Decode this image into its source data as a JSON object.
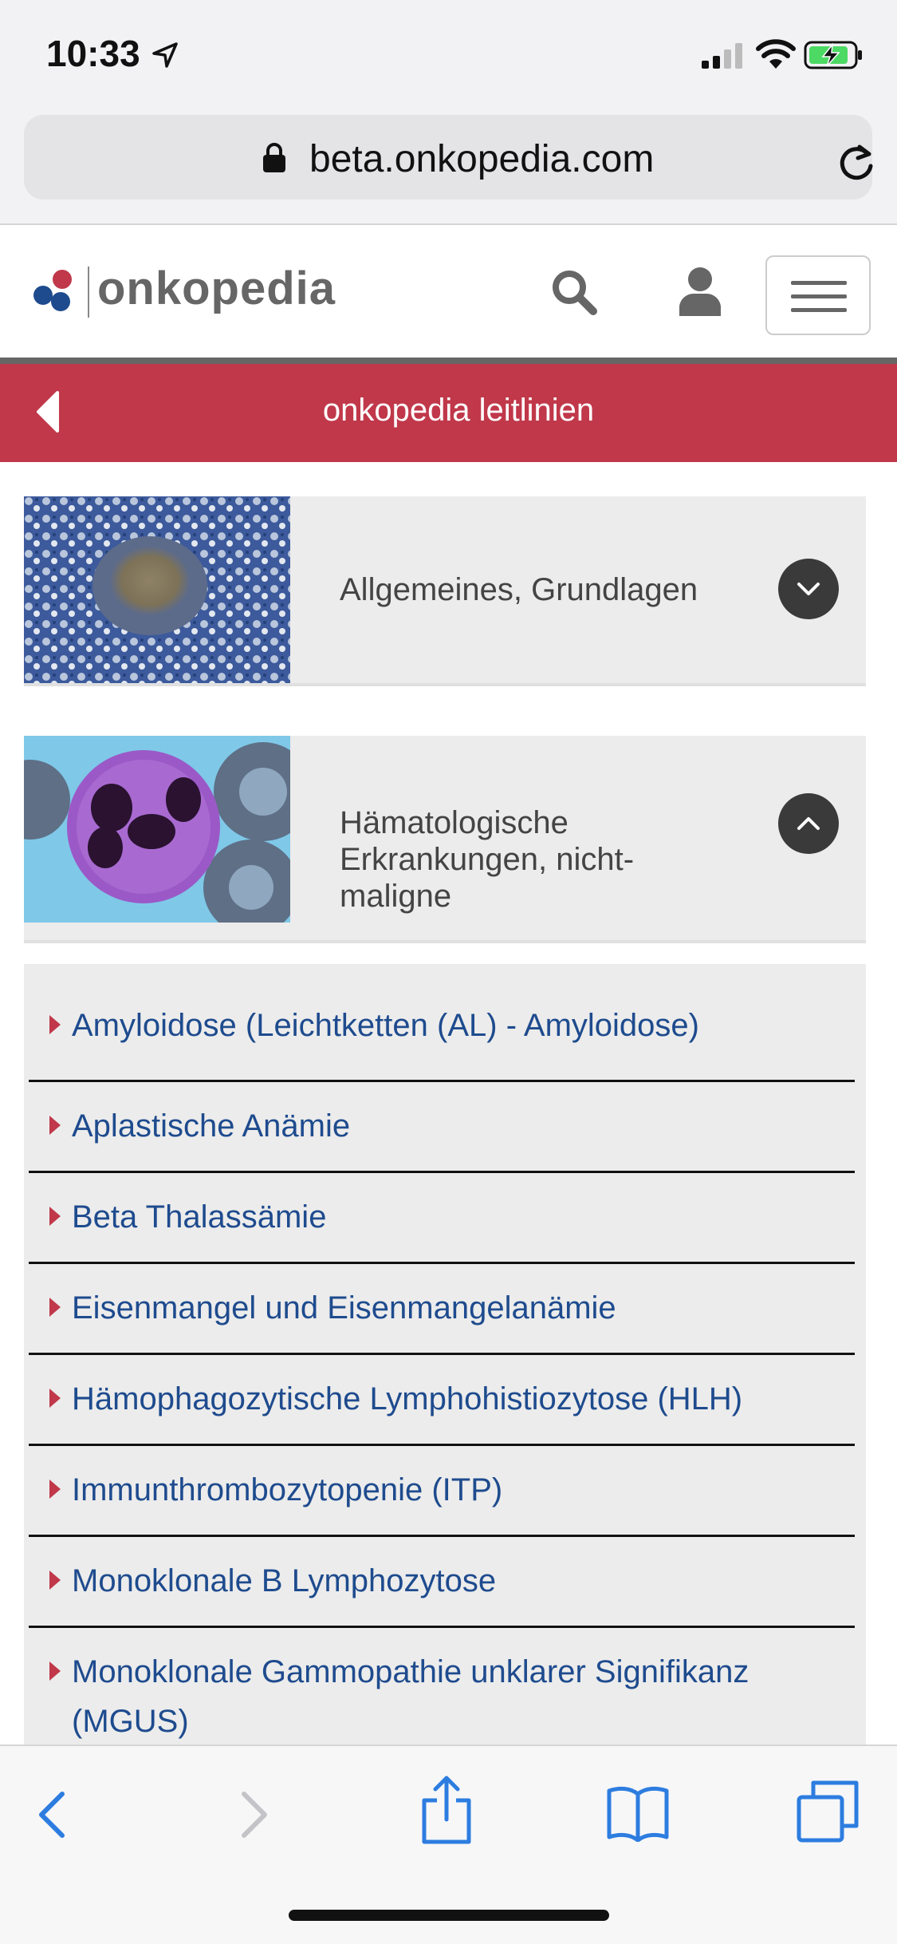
{
  "status_bar": {
    "time": "10:33",
    "icons": [
      "location-arrow-icon",
      "cellular-signal-icon",
      "wifi-icon",
      "battery-charging-icon"
    ]
  },
  "address_bar": {
    "url": "beta.onkopedia.com"
  },
  "header": {
    "logo_text": "onkopedia",
    "logo_colors": [
      "#c0384a",
      "#1e4b8e",
      "#1e4b8e"
    ]
  },
  "section": {
    "title": "onkopedia leitlinien",
    "accent_color": "#c0384a"
  },
  "categories": [
    {
      "title": "Allgemeines, Grundlagen",
      "expanded": false
    },
    {
      "title": "Hämatologische Erkrankungen, nicht-maligne",
      "title_lines": [
        "Hämatologische",
        "Erkrankungen, nicht-",
        "maligne"
      ],
      "expanded": true
    }
  ],
  "list": {
    "items": [
      {
        "label": "Amyloidose (Leichtketten (AL) - Amyloidose)"
      },
      {
        "label": "Aplastische Anämie"
      },
      {
        "label": "Beta Thalassämie"
      },
      {
        "label": "Eisenmangel und Eisenmangelanämie"
      },
      {
        "label": "Hämophagozytische Lymphohistiozytose (HLH)"
      },
      {
        "label": "Immunthrombozytopenie (ITP)"
      },
      {
        "label": "Monoklonale B Lymphozytose"
      },
      {
        "label": "Monoklonale Gammopathie unklarer Signifikanz (MGUS)"
      }
    ],
    "link_color": "#1e4b8e"
  },
  "toolbar": {
    "icons": [
      "back-icon",
      "forward-icon",
      "share-icon",
      "bookmarks-icon",
      "tabs-icon"
    ],
    "tint": "#2d7de0"
  }
}
